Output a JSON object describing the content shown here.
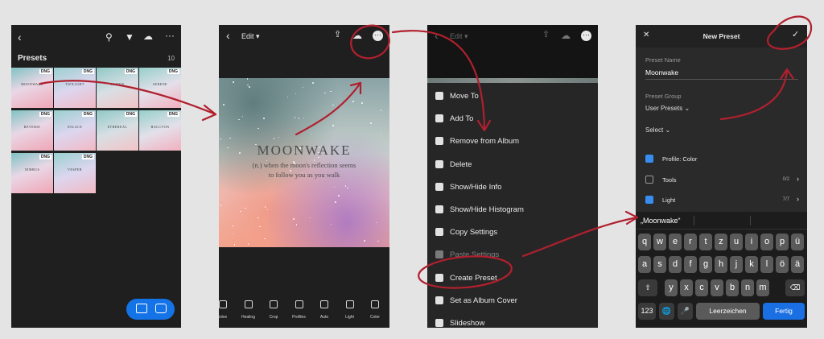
{
  "colors": {
    "accent": "#1473e6",
    "annotation": "#b0202e",
    "check_on": "#378ef0",
    "key_return": "#1a6fe3"
  },
  "screen1": {
    "title": "Presets",
    "count": "10",
    "icons": [
      "back-chevron-icon",
      "person-search-icon",
      "filter-icon",
      "cloud-sync-icon",
      "more-icon"
    ],
    "thumbnails": [
      {
        "label": "MOONWAKE",
        "badge": "DNG"
      },
      {
        "label": "TWILIGHT",
        "badge": "DNG"
      },
      {
        "label": "LUMEN",
        "badge": "DNG"
      },
      {
        "label": "SERENE",
        "badge": "DNG"
      },
      {
        "label": "REVERIE",
        "badge": "DNG"
      },
      {
        "label": "SOLACE",
        "badge": "DNG"
      },
      {
        "label": "ETHEREAL",
        "badge": "DNG"
      },
      {
        "label": "HALCYON",
        "badge": "DNG"
      },
      {
        "label": "NIMBUS",
        "badge": "DNG"
      },
      {
        "label": "VESPER",
        "badge": "DNG"
      }
    ]
  },
  "screen2": {
    "edit_label": "Edit ▾",
    "photo_title": "MOONWAKE",
    "photo_line1": "(n.) when the moon's reflection seems",
    "photo_line2": "to follow you as you walk",
    "tools": [
      "ctive",
      "Healing",
      "Crop",
      "Profiles",
      "Auto",
      "Light",
      "Color"
    ]
  },
  "screen3": {
    "edit_label": "Edit ▾",
    "menu": [
      {
        "label": "Move To",
        "icon": "move-to-icon"
      },
      {
        "label": "Add To",
        "icon": "add-to-icon"
      },
      {
        "label": "Remove from Album",
        "icon": "remove-icon"
      },
      {
        "label": "Delete",
        "icon": "trash-icon"
      },
      {
        "label": "Show/Hide Info",
        "icon": "info-icon"
      },
      {
        "label": "Show/Hide Histogram",
        "icon": "histogram-icon"
      },
      {
        "label": "Copy Settings",
        "icon": "copy-settings-icon"
      },
      {
        "label": "Paste Settings",
        "icon": "paste-settings-icon"
      },
      {
        "label": "Create Preset",
        "icon": "create-preset-icon"
      },
      {
        "label": "Set as Album Cover",
        "icon": "album-cover-icon"
      },
      {
        "label": "Slideshow",
        "icon": "slideshow-icon"
      }
    ]
  },
  "screen4": {
    "title": "New Preset",
    "close_icon": "✕",
    "check_icon": "✓",
    "preset_name_label": "Preset Name",
    "preset_name_value": "Moonwake",
    "preset_group_label": "Preset Group",
    "preset_group_value": "User Presets",
    "select_label": "Select",
    "rows": [
      {
        "label": "Profile: Color",
        "checked": true,
        "count": ""
      },
      {
        "label": "Tools",
        "checked": false,
        "count": "0/2"
      },
      {
        "label": "Light",
        "checked": true,
        "count": "7/7"
      }
    ],
    "suggestion": "„Moonwake“",
    "keyboard": {
      "row1": [
        "q",
        "w",
        "e",
        "r",
        "t",
        "z",
        "u",
        "i",
        "o",
        "p",
        "ü"
      ],
      "row2": [
        "a",
        "s",
        "d",
        "f",
        "g",
        "h",
        "j",
        "k",
        "l",
        "ö",
        "ä"
      ],
      "row3": [
        "y",
        "x",
        "c",
        "v",
        "b",
        "n",
        "m"
      ],
      "num_key": "123",
      "space_key": "Leerzeichen",
      "return_key": "Fertig"
    }
  }
}
